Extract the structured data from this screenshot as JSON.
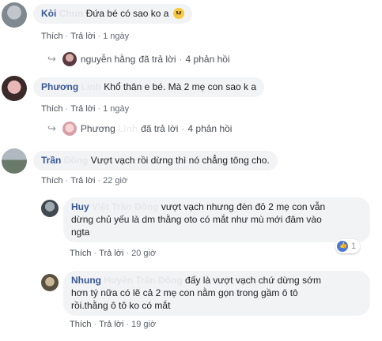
{
  "comments": [
    {
      "name": "Kòi",
      "name_hidden": "Chun",
      "text": "Đứa bé có sao ko a",
      "like": "Thích",
      "reply": "Trả lời",
      "time": "1 ngày",
      "avatar_colors": [
        "#c0c6cc",
        "#808890"
      ],
      "replies_row": {
        "name": "nguyễn hằng",
        "text": "đã trả lời",
        "count": "4 phản hồi",
        "avatar_colors": [
          "#5a3a40",
          "#d8b0a8"
        ]
      }
    },
    {
      "name": "Phương",
      "name_hidden": "Linh",
      "text": "Khổ thân e bé. Mà 2 mẹ con sao k a",
      "like": "Thích",
      "reply": "Trả lời",
      "time": "1 ngày",
      "avatar_colors": [
        "#3a2a2a",
        "#e8b8b8"
      ],
      "replies_row": {
        "name": "Phương",
        "name_hidden": "Linh",
        "text": "đã trả lời",
        "count": "4 phản hồi",
        "avatar_colors": [
          "#d6a0a8",
          "#f5d5d5"
        ]
      }
    },
    {
      "name": "Trần",
      "name_hidden": "Đồng",
      "text": "Vượt vạch rồi dừng thì nó chẳng tông cho.",
      "like": "Thích",
      "reply": "Trả lời",
      "time": "22 giờ",
      "avatar_colors": [
        "#6a7a6a",
        "#b0b8c0"
      ]
    }
  ],
  "replies": [
    {
      "name": "Huy",
      "name_hidden": "Việt Trần Đồng",
      "text_line1": "vượt vạch nhưng đèn đỏ 2 mẹ con vẫn",
      "text_line2": "dừng chủ yếu là dm thằng oto có mắt như mù mới đâm vào",
      "text_line3": "ngta",
      "like": "Thích",
      "reply": "Trả lời",
      "time": "20 giờ",
      "reaction_count": "1",
      "avatar_colors": [
        "#404850",
        "#a0a8b0"
      ]
    },
    {
      "name": "Nhung",
      "name_hidden": "Huyền Trần Đồng",
      "text_line1": "đấy là vượt vạch chứ dừng sớm",
      "text_line2": "hơn tý nữa có lẽ cả 2 mẹ con nằm gọn trong gầm ô tô",
      "text_line3": "rồi.thằng ô tô ko có mắt",
      "like": "Thích",
      "reply": "Trả lời",
      "time": "19 giờ",
      "avatar_colors": [
        "#5a5040",
        "#c8b898"
      ]
    }
  ],
  "colors": {
    "name": "#385898",
    "bubble": "#f2f3f5",
    "meta": "#606770",
    "like_blue": "#4a78d9"
  }
}
